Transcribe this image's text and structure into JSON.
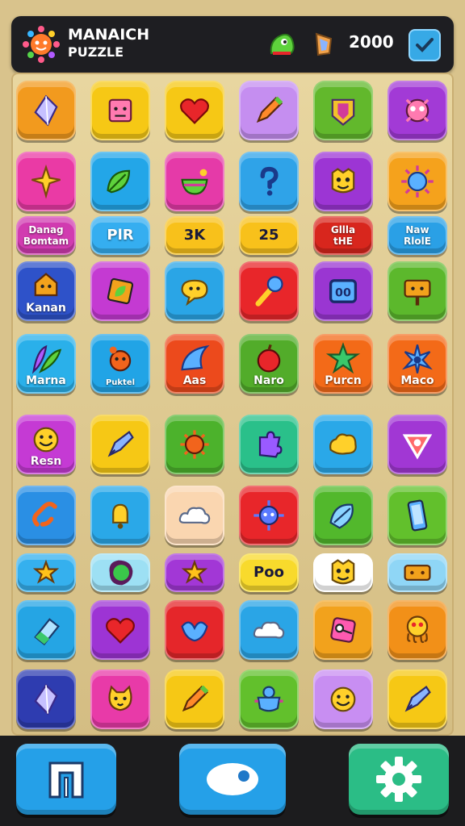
{
  "header": {
    "title_line1": "MANAICH",
    "title_line2": "PUZZLE",
    "score": "2000",
    "icons": [
      "sun-logo-icon",
      "slime-icon",
      "gem-icon",
      "check-icon"
    ]
  },
  "board": {
    "tiles": [
      {
        "icon": "crystal-icon",
        "color": "#f29a1e",
        "label": ""
      },
      {
        "icon": "cube-face-icon",
        "color": "#f6c815",
        "label": ""
      },
      {
        "icon": "heart-icon",
        "color": "#f6c815",
        "label": ""
      },
      {
        "icon": "pencil-icon",
        "color": "#c58ef0",
        "label": ""
      },
      {
        "icon": "shield-icon",
        "color": "#62b82c",
        "label": ""
      },
      {
        "icon": "monster-icon",
        "color": "#a23ad6",
        "label": ""
      },
      {
        "icon": "star-diamond-icon",
        "color": "#ea3aa5",
        "label": ""
      },
      {
        "icon": "leaf-icon",
        "color": "#23a6e8",
        "label": ""
      },
      {
        "icon": "bowl-icon",
        "color": "#e53aa8",
        "label": ""
      },
      {
        "icon": "question-icon",
        "color": "#2fa3e8",
        "label": ""
      },
      {
        "icon": "face-icon",
        "color": "#9c35d4",
        "label": ""
      },
      {
        "icon": "sun-face-icon",
        "color": "#f5a21c",
        "label": ""
      },
      {
        "icon": "",
        "color": "#d13bb0",
        "label": "Danag\nBomtam"
      },
      {
        "icon": "",
        "color": "#35aef0",
        "label": "PlR"
      },
      {
        "icon": "",
        "color": "#f8c11b",
        "label": "3K"
      },
      {
        "icon": "",
        "color": "#f8c11b",
        "label": "25"
      },
      {
        "icon": "",
        "color": "#d8261d",
        "label": "Gllla\ntHE"
      },
      {
        "icon": "",
        "color": "#2aa0e6",
        "label": "Naw\nRlolE"
      },
      {
        "icon": "house-icon",
        "color": "#2e52c9",
        "label": "Kanan"
      },
      {
        "icon": "leaf-box-icon",
        "color": "#c43ad2",
        "label": ""
      },
      {
        "icon": "bubble-icon",
        "color": "#2aa5e6",
        "label": ""
      },
      {
        "icon": "wand-icon",
        "color": "#e8262a",
        "label": ""
      },
      {
        "icon": "frame-icon",
        "color": "#9a36d2",
        "label": ""
      },
      {
        "icon": "sign-icon",
        "color": "#5cb82c",
        "label": ""
      },
      {
        "icon": "fern-icon",
        "color": "#2ab0ea",
        "label": "Marna"
      },
      {
        "icon": "bear-icon",
        "color": "#21a4e6",
        "label": "Puktel"
      },
      {
        "icon": "fin-icon",
        "color": "#ec4a1c",
        "label": "Aas"
      },
      {
        "icon": "apple-icon",
        "color": "#52ac2a",
        "label": "Naro"
      },
      {
        "icon": "star-icon",
        "color": "#f36a18",
        "label": "Purcn"
      },
      {
        "icon": "spark-icon",
        "color": "#f36a18",
        "label": "Maco"
      },
      {
        "icon": "smile-icon",
        "color": "#c53ad4",
        "label": "Resn"
      },
      {
        "icon": "pen-icon",
        "color": "#f6c815",
        "label": ""
      },
      {
        "icon": "virus-icon",
        "color": "#4cb22c",
        "label": ""
      },
      {
        "icon": "puzzle-icon",
        "color": "#2ac08a",
        "label": ""
      },
      {
        "icon": "blob-icon",
        "color": "#2aa8e8",
        "label": ""
      },
      {
        "icon": "triangle-icon",
        "color": "#a137d4",
        "label": ""
      },
      {
        "icon": "link-icon",
        "color": "#2a8fe4",
        "label": ""
      },
      {
        "icon": "bell-icon",
        "color": "#2aa8e8",
        "label": ""
      },
      {
        "icon": "cloud-icon",
        "color": "#fad6b0",
        "label": ""
      },
      {
        "icon": "spiky-icon",
        "color": "#e8262a",
        "label": ""
      },
      {
        "icon": "shell-icon",
        "color": "#52b82c",
        "label": ""
      },
      {
        "icon": "phone-icon",
        "color": "#62c02c",
        "label": ""
      },
      {
        "icon": "star-small-icon",
        "color": "#35b0ee",
        "label": ""
      },
      {
        "icon": "ball-icon",
        "color": "#9de0f4",
        "label": ""
      },
      {
        "icon": "star-small-icon",
        "color": "#a237d6",
        "label": ""
      },
      {
        "icon": "",
        "color": "#f8da2c",
        "label": "Poo"
      },
      {
        "icon": "face-icon",
        "color": "#ffffff",
        "label": ""
      },
      {
        "icon": "tape-icon",
        "color": "#8fd6f6",
        "label": ""
      },
      {
        "icon": "eraser-icon",
        "color": "#25a5e4",
        "label": ""
      },
      {
        "icon": "heart-icon",
        "color": "#9d34d4",
        "label": ""
      },
      {
        "icon": "bird-icon",
        "color": "#e5262a",
        "label": ""
      },
      {
        "icon": "cloud-icon",
        "color": "#2aa5e6",
        "label": ""
      },
      {
        "icon": "key-icon",
        "color": "#f2a21c",
        "label": ""
      },
      {
        "icon": "octopus-icon",
        "color": "#f29018",
        "label": ""
      },
      {
        "icon": "crystal-icon",
        "color": "#2e3cb0",
        "label": ""
      },
      {
        "icon": "cat-icon",
        "color": "#e83aa8",
        "label": ""
      },
      {
        "icon": "pencil-icon",
        "color": "#f6c815",
        "label": ""
      },
      {
        "icon": "pot-icon",
        "color": "#62c02c",
        "label": ""
      },
      {
        "icon": "smile-icon",
        "color": "#c88ef2",
        "label": ""
      },
      {
        "icon": "pen-icon",
        "color": "#f6c815",
        "label": ""
      }
    ]
  },
  "bottom": {
    "buttons": [
      {
        "name": "home-button",
        "icon": "gate-icon",
        "color": "#25a0e8"
      },
      {
        "name": "view-button",
        "icon": "eye-icon",
        "color": "#25a0e8"
      },
      {
        "name": "settings-button",
        "icon": "gear-icon",
        "color": "#2bbd86"
      }
    ]
  }
}
